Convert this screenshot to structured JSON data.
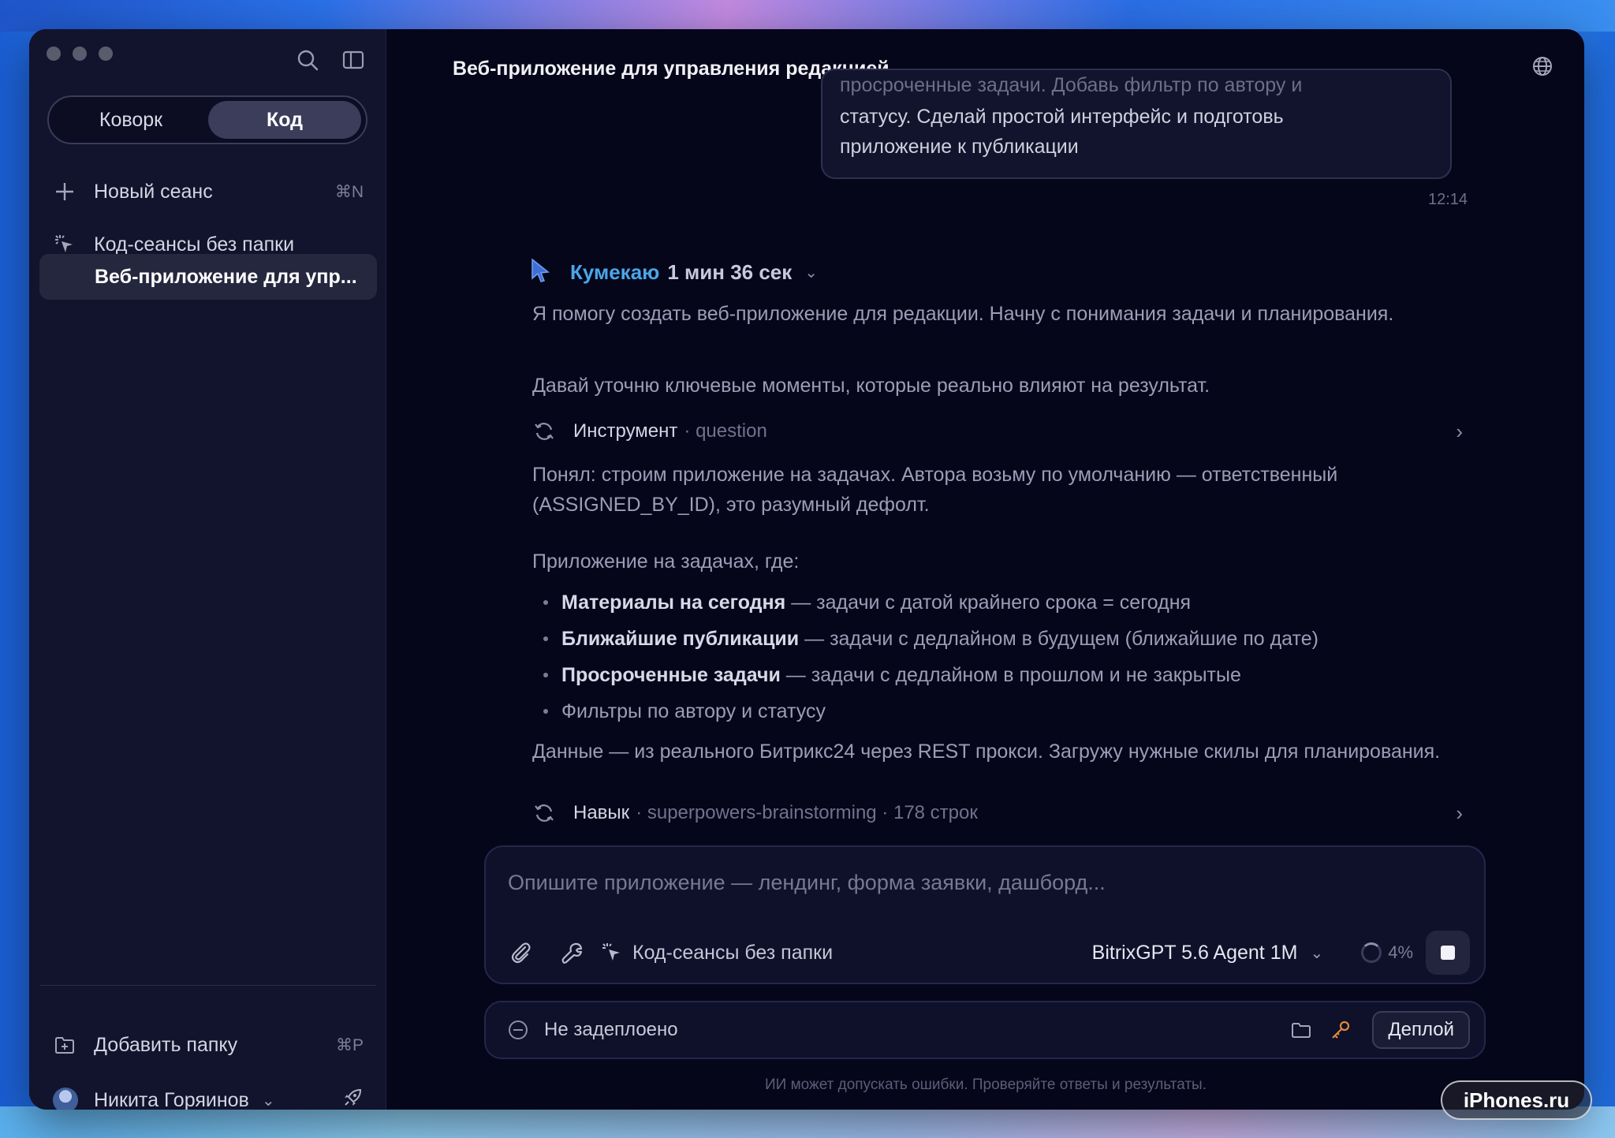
{
  "sidebar": {
    "mode_tabs": [
      "Коворк",
      "Код"
    ],
    "new_session": {
      "label": "Новый сеанс",
      "shortcut": "⌘N"
    },
    "folder_label": "Код-сеансы без папки",
    "active_session": "Веб-приложение для упр...",
    "add_folder": {
      "label": "Добавить папку",
      "shortcut": "⌘P"
    },
    "user_name": "Никита Горяинов"
  },
  "header": {
    "title": "Веб-приложение для управления редакцией"
  },
  "user_message": {
    "faded_line": "просроченные задачи. Добавь фильтр по автору и",
    "line1": "статусу. Сделай простой интерфейс и подготовь",
    "line2": "приложение к публикации",
    "time": "12:14"
  },
  "agent": {
    "name": "Кумекаю",
    "duration": "1 мин 36 сек",
    "p1": "Я помогу создать веб-приложение для редакции. Начну с понимания задачи и планирования.",
    "p2": "Давай уточню ключевые моменты, которые реально влияют на результат.",
    "tool1": {
      "name": "Инструмент",
      "detail": "· question"
    },
    "p3": "Понял: строим приложение на задачах. Автора возьму по умолчанию — ответственный (ASSIGNED_BY_ID), это разумный дефолт.",
    "p4": "Приложение на задачах, где:",
    "bullets": [
      {
        "bold": "Материалы на сегодня",
        "rest": " — задачи с датой крайнего срока = сегодня"
      },
      {
        "bold": "Ближайшие публикации",
        "rest": " — задачи с дедлайном в будущем (ближайшие по дате)"
      },
      {
        "bold": "Просроченные задачи",
        "rest": " — задачи с дедлайном в прошлом и не закрытые"
      },
      {
        "bold": "",
        "rest": "Фильтры по автору и статусу"
      }
    ],
    "p5": "Данные — из реального Битрикс24 через REST прокси. Загружу нужные скилы для планирования.",
    "tool2": {
      "name": "Навык",
      "detail": "· superpowers-brainstorming · 178 строк"
    }
  },
  "composer": {
    "placeholder": "Опишите приложение — лендинг, форма заявки, дашборд...",
    "folder": "Код-сеансы без папки",
    "model": "BitrixGPT 5.6 Agent 1M",
    "context_usage": "4%"
  },
  "deploy": {
    "status": "Не задеплоено",
    "button": "Деплой"
  },
  "disclaimer": "ИИ может допускать ошибки. Проверяйте ответы и результаты.",
  "watermark": "iPhones.ru",
  "icons": [
    "search-icon",
    "sidebar-toggle-icon",
    "plus-icon",
    "sparkle-icon",
    "add-folder-icon",
    "rocket-icon",
    "globe-icon",
    "cursor-icon",
    "refresh-icon",
    "chevron-right-icon",
    "paperclip-icon",
    "wrench-icon",
    "folder-icon",
    "key-icon",
    "stop-icon"
  ],
  "colors": {
    "accent": "#4aa6e8",
    "key": "#e0883a"
  }
}
